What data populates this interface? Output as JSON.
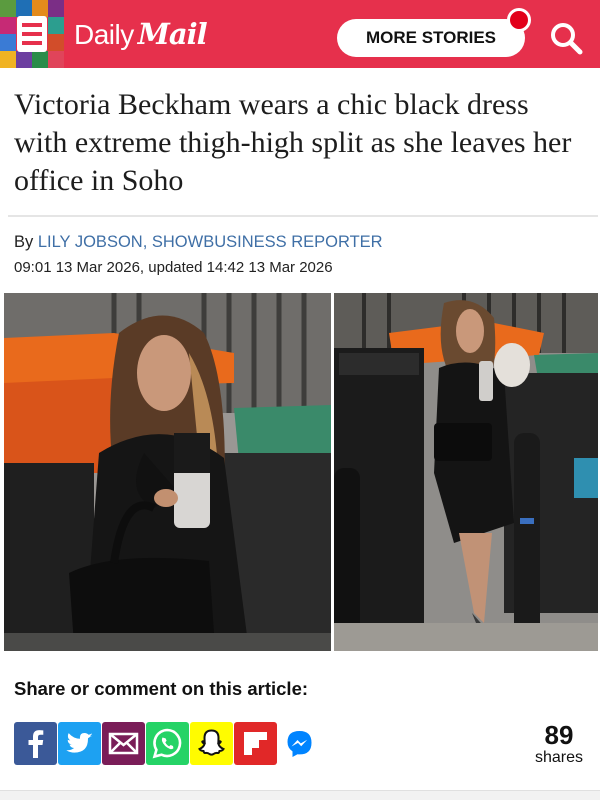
{
  "header": {
    "logo_daily": "Daily",
    "logo_mail": "Mail",
    "more_stories_label": "MORE STORIES",
    "brand_color": "#e6304c",
    "icons": [
      "menu-icon",
      "search-icon",
      "notification-dot"
    ]
  },
  "article": {
    "headline": "Victoria Beckham wears a chic black dress with extreme thigh-high split as she leaves her office in Soho",
    "byline_prefix": "By ",
    "author": "LILY JOBSON, SHOWBUSINESS REPORTER",
    "dateline": "09:01 13 Mar 2026, updated 14:42 13 Mar 2026"
  },
  "share": {
    "title": "Share or comment on this article:",
    "count": "89",
    "count_label": "shares",
    "buttons": [
      {
        "name": "facebook",
        "color": "#3b5998"
      },
      {
        "name": "twitter",
        "color": "#1da1f2"
      },
      {
        "name": "email",
        "color": "#7a1d58"
      },
      {
        "name": "whatsapp",
        "color": "#25d366"
      },
      {
        "name": "snapchat",
        "color": "#fffc00"
      },
      {
        "name": "flipboard",
        "color": "#e12828"
      },
      {
        "name": "messenger",
        "color": "#0084ff"
      }
    ]
  }
}
